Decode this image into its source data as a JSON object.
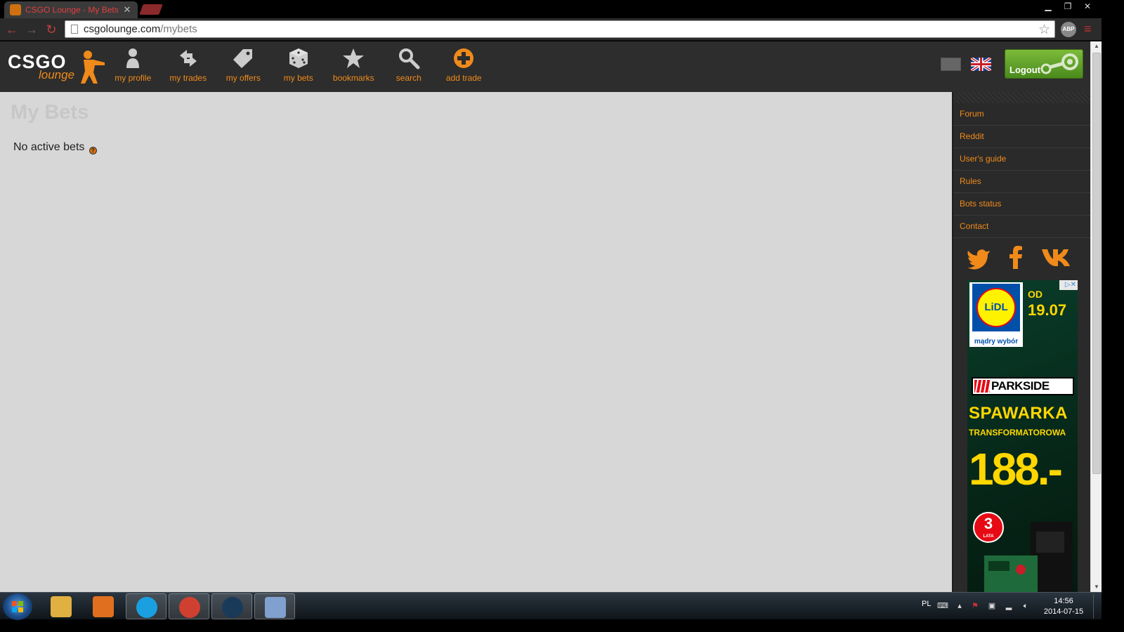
{
  "browser": {
    "tab_title": "CSGO Lounge - My Bets",
    "tab_close": "✕",
    "url_host": "csgolounge.com",
    "url_path": "/mybets",
    "abp_label": "ABP"
  },
  "site": {
    "logo_csgo": "CSGO",
    "logo_lounge": "lounge",
    "nav": [
      {
        "label": "my profile",
        "icon": "profile-icon"
      },
      {
        "label": "my trades",
        "icon": "trades-icon"
      },
      {
        "label": "my offers",
        "icon": "offers-icon"
      },
      {
        "label": "my bets",
        "icon": "dice-icon"
      },
      {
        "label": "bookmarks",
        "icon": "star-icon"
      },
      {
        "label": "search",
        "icon": "search-icon"
      },
      {
        "label": "add trade",
        "icon": "plus-circle-icon"
      }
    ],
    "logout_label": "Logout",
    "accent_color": "#f08a1a"
  },
  "main": {
    "title": "My Bets",
    "empty_message": "No active bets",
    "help_glyph": "?"
  },
  "sidebar": {
    "links": [
      {
        "label": "Forum"
      },
      {
        "label": "Reddit"
      },
      {
        "label": "User's guide"
      },
      {
        "label": "Rules"
      },
      {
        "label": "Bots status"
      },
      {
        "label": "Contact"
      }
    ],
    "social": [
      "twitter-icon",
      "facebook-icon",
      "vk-icon"
    ]
  },
  "ad": {
    "adchoices": "▷✕",
    "lidl_logo": "LiDL",
    "lidl_slogan": "mądry wybór",
    "od": "OD",
    "date": "19.07",
    "brand": "PARKSIDE",
    "product": "SPAWARKA",
    "product_sub": "TRANSFORMATOROWA",
    "price": "188.-",
    "warranty_years": "3",
    "warranty_label": "LATA"
  },
  "taskbar": {
    "apps": [
      {
        "name": "explorer",
        "color": "#e0b040",
        "active": false
      },
      {
        "name": "media-player",
        "color": "#e07020",
        "active": false
      },
      {
        "name": "skype",
        "color": "#1aa0e0",
        "active": true
      },
      {
        "name": "chrome",
        "color": "#d04030",
        "active": true
      },
      {
        "name": "steam",
        "color": "#1a3a5a",
        "active": true
      },
      {
        "name": "paint",
        "color": "#80a0d0",
        "active": true
      }
    ],
    "language": "PL",
    "time": "14:56",
    "date": "2014-07-15"
  }
}
